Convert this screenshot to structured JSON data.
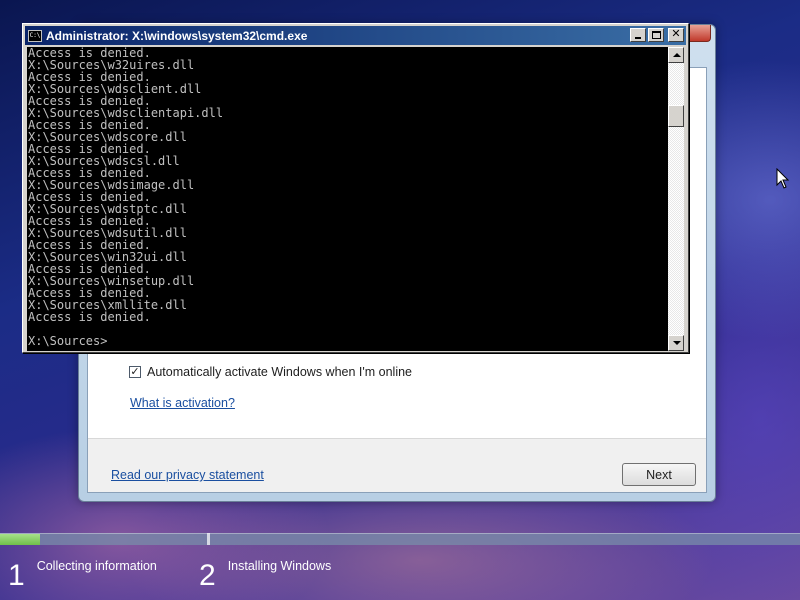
{
  "cmd": {
    "title": "Administrator: X:\\windows\\system32\\cmd.exe",
    "icon_text": "C:\\",
    "output": [
      "Access is denied.",
      "X:\\Sources\\w32uires.dll",
      "Access is denied.",
      "X:\\Sources\\wdsclient.dll",
      "Access is denied.",
      "X:\\Sources\\wdsclientapi.dll",
      "Access is denied.",
      "X:\\Sources\\wdscore.dll",
      "Access is denied.",
      "X:\\Sources\\wdscsl.dll",
      "Access is denied.",
      "X:\\Sources\\wdsimage.dll",
      "Access is denied.",
      "X:\\Sources\\wdstptc.dll",
      "Access is denied.",
      "X:\\Sources\\wdsutil.dll",
      "Access is denied.",
      "X:\\Sources\\win32ui.dll",
      "Access is denied.",
      "X:\\Sources\\winsetup.dll",
      "Access is denied.",
      "X:\\Sources\\xmllite.dll",
      "Access is denied."
    ],
    "prompt": "X:\\Sources>"
  },
  "setup": {
    "activate_checkbox_label": "Automatically activate Windows when I'm online",
    "activate_checked": true,
    "what_is_activation": "What is activation?",
    "privacy_link": "Read our privacy statement",
    "next_button": "Next"
  },
  "progress": {
    "fraction": 0.05,
    "steps": [
      {
        "number": "1",
        "label": "Collecting information"
      },
      {
        "number": "2",
        "label": "Installing Windows"
      }
    ]
  },
  "colors": {
    "progress_fill": "#6fc04a",
    "cmd_titlebar": "#0a246a",
    "console_text": "#c0c0c0"
  },
  "icons": {
    "cmd": "cmd-icon",
    "cursor": "mouse-cursor-icon",
    "minimize": "minimize-icon",
    "maximize": "maximize-icon",
    "close": "close-icon"
  }
}
